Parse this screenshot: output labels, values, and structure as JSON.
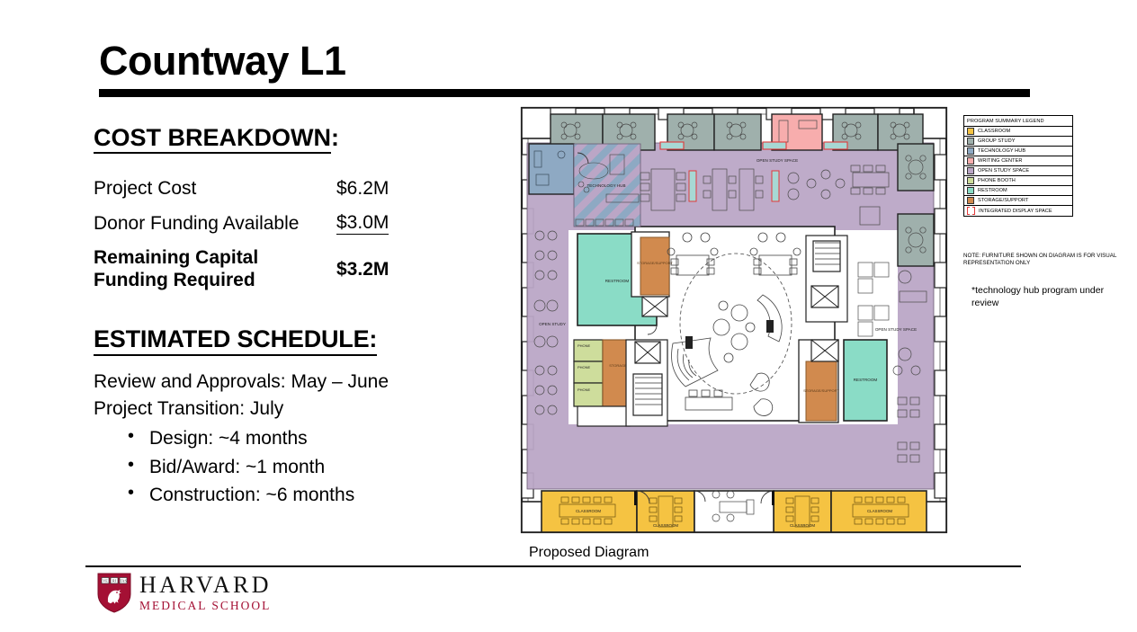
{
  "slide": {
    "title": "Countway L1"
  },
  "cost": {
    "heading": "COST BREAKDOWN",
    "heading_colon": ":",
    "rows": [
      {
        "label": "Project Cost",
        "value": "$6.2M",
        "bold": false,
        "underline": false
      },
      {
        "label": "Donor Funding Available",
        "value": "$3.0M",
        "bold": false,
        "underline": true
      },
      {
        "label": "Remaining Capital Funding Required",
        "label_line1": "Remaining Capital",
        "label_line2": "Funding Required",
        "value": "$3.2M",
        "bold": true,
        "underline": false
      }
    ]
  },
  "schedule": {
    "heading": "ESTIMATED SCHEDULE:",
    "lines": [
      "Review and Approvals: May – June",
      "Project Transition: July"
    ],
    "bullets": [
      "Design: ~4 months",
      "Bid/Award: ~1 month",
      "Construction: ~6 months"
    ]
  },
  "logo": {
    "primary": "HARVARD",
    "secondary": "MEDICAL SCHOOL",
    "crimson": "#a41034"
  },
  "diagram": {
    "caption": "Proposed Diagram",
    "room_labels": {
      "technology_hub": "TECHNOLOGY HUB",
      "open_study_space_top": "OPEN STUDY SPACE",
      "open_study_left": "OPEN STUDY",
      "open_study_space_right": "OPEN STUDY SPACE",
      "restroom": "RESTROOM",
      "storage_support": "STORAGE/SUPPORT",
      "storage": "STORAGE",
      "phone": "PHONE",
      "classroom": "CLASSROOM"
    }
  },
  "legend": {
    "header": "PROGRAM SUMMARY LEGEND",
    "items": [
      {
        "label": "CLASSROOM",
        "color": "#F5C342"
      },
      {
        "label": "GROUP STUDY",
        "color": "#9FB0AC"
      },
      {
        "label": "TECHNOLOGY HUB",
        "color": "#8EA9C3"
      },
      {
        "label": "WRITING CENTER",
        "color": "#F7ADAD"
      },
      {
        "label": "OPEN STUDY SPACE",
        "color": "#BBA6C6"
      },
      {
        "label": "PHONE BOOTH",
        "color": "#CEDD9C"
      },
      {
        "label": "RESTROOM",
        "color": "#8ADCC6"
      },
      {
        "label": "STORAGE/SUPPORT",
        "color": "#D18A4E"
      },
      {
        "label": "INTEGRATED DISPLAY SPACE",
        "color": "#E03A3A",
        "icon": "bracket-icon"
      }
    ],
    "note": "NOTE: FURNITURE SHOWN ON DIAGRAM IS FOR VISUAL REPRESENTATION ONLY",
    "tech_note": "*technology hub program under review"
  }
}
